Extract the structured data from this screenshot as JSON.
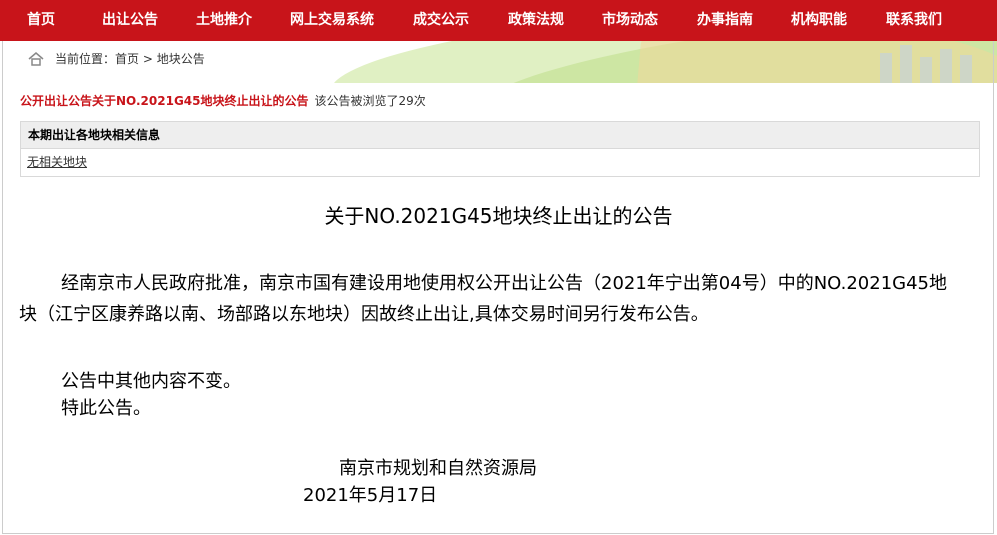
{
  "nav": {
    "items": [
      {
        "label": "首页"
      },
      {
        "label": "出让公告"
      },
      {
        "label": "土地推介"
      },
      {
        "label": "网上交易系统"
      },
      {
        "label": "成交公示"
      },
      {
        "label": "政策法规"
      },
      {
        "label": "市场动态"
      },
      {
        "label": "办事指南"
      },
      {
        "label": "机构职能"
      },
      {
        "label": "联系我们"
      }
    ]
  },
  "breadcrumb": {
    "prefix": "当前位置：",
    "home": "首页",
    "separator": " > ",
    "current": "地块公告"
  },
  "notice": {
    "title": "公开出让公告关于NO.2021G45地块终止出让的公告",
    "views": "该公告被浏览了29次"
  },
  "info_table": {
    "header": "本期出让各地块相关信息",
    "row": "无相关地块"
  },
  "document": {
    "title": "关于NO.2021G45地块终止出让的公告",
    "paragraph1": "经南京市人民政府批准，南京市国有建设用地使用权公开出让公告（2021年宁出第04号）中的NO.2021G45地块（江宁区康养路以南、场部路以东地块）因故终止出让,具体交易时间另行发布公告。",
    "paragraph2": "公告中其他内容不变。",
    "paragraph3": "特此公告。",
    "signature_org": "南京市规划和自然资源局",
    "signature_date": "2021年5月17日"
  },
  "colors": {
    "nav_background": "#c8141a",
    "title_red": "#c8141a",
    "table_header": "#eeeeee"
  },
  "icons": {
    "breadcrumb": "home-icon"
  }
}
